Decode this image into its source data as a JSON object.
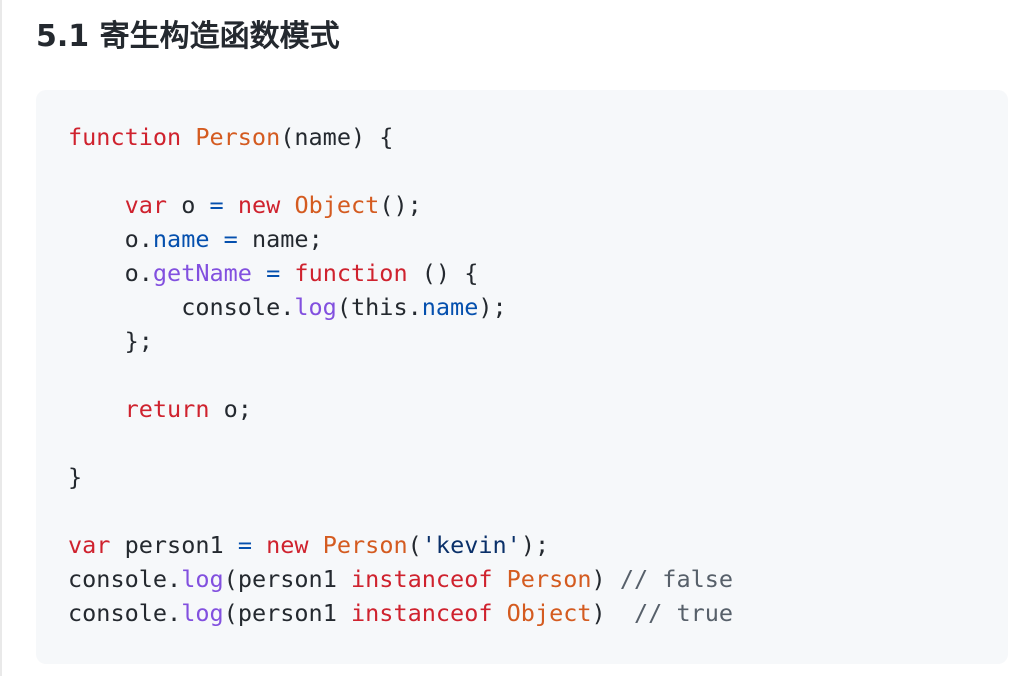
{
  "heading": "5.1 寄生构造函数模式",
  "code": {
    "language": "javascript",
    "lines": [
      "function Person(name) {",
      "",
      "    var o = new Object();",
      "    o.name = name;",
      "    o.getName = function () {",
      "        console.log(this.name);",
      "    };",
      "",
      "    return o;",
      "",
      "}",
      "",
      "var person1 = new Person('kevin');",
      "console.log(person1 instanceof Person) // false",
      "console.log(person1 instanceof Object)  // true"
    ],
    "colors": {
      "keyword": "#cf222e",
      "function_name": "#d45b20",
      "property": "#0550ae",
      "method": "#8250df",
      "string": "#0a3069",
      "comment": "#57606a",
      "background": "#f6f8fa"
    }
  }
}
